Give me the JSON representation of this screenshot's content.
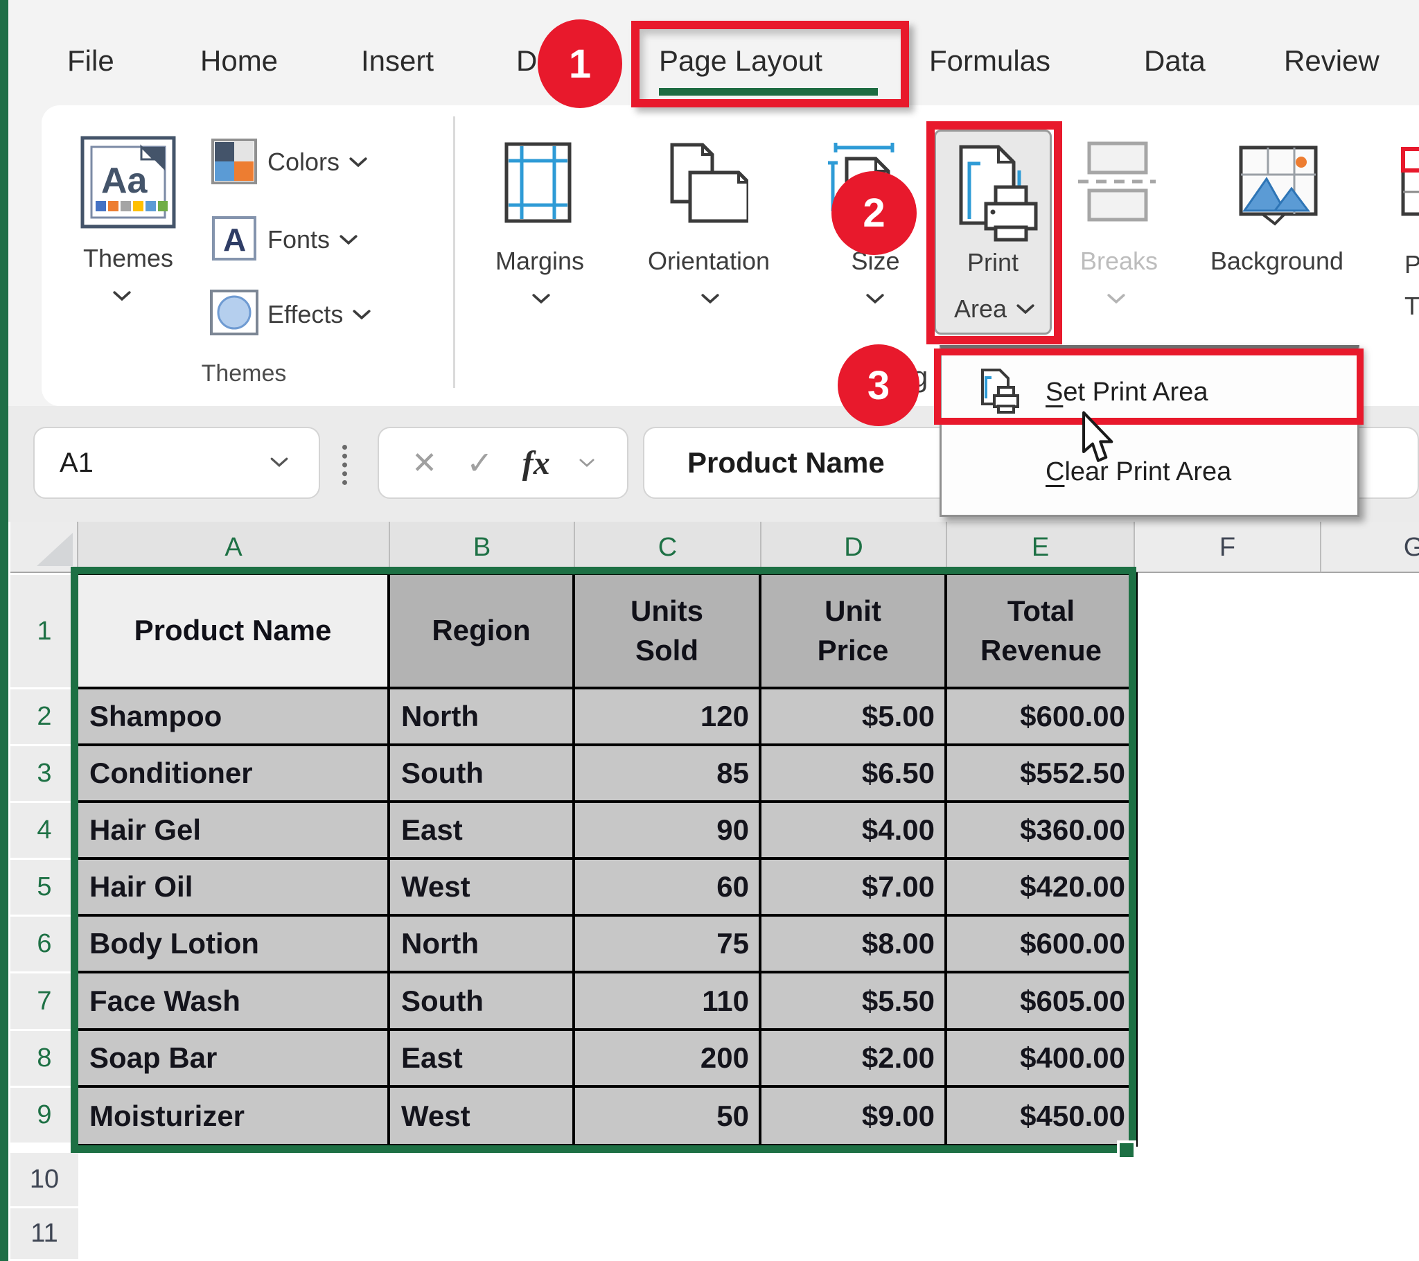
{
  "colors": {
    "excel_green": "#217346",
    "selection_border": "#1d7044",
    "annotation_red": "#e8192c",
    "disabled_text": "#bdbdbd"
  },
  "ribbon": {
    "tabs": [
      {
        "label": "File"
      },
      {
        "label": "Home"
      },
      {
        "label": "Insert"
      },
      {
        "label": "D"
      },
      {
        "label": "Page Layout"
      },
      {
        "label": "Formulas"
      },
      {
        "label": "Data"
      },
      {
        "label": "Review"
      }
    ],
    "active_tab": "Page Layout",
    "themes_group": {
      "group_label": "Themes",
      "themes_label": "Themes",
      "themes_icon_glyph": "Aa",
      "colors_label": "Colors",
      "fonts_label": "Fonts",
      "fonts_icon_glyph": "A",
      "effects_label": "Effects"
    },
    "page_setup_group": {
      "margins_label": "Margins",
      "orientation_label": "Orientation",
      "size_label": "Size",
      "print_area_line1": "Print",
      "print_area_line2": "Area",
      "breaks_label": "Breaks",
      "background_label": "Background",
      "print_titles_label": "Print\nTitles",
      "label_fragment": "g"
    }
  },
  "formula_bar": {
    "name_box_value": "A1",
    "cancel_glyph": "✕",
    "enter_glyph": "✓",
    "fx_label": "fx",
    "value": "Product Name"
  },
  "print_area_menu": {
    "items": [
      {
        "label": "Set Print Area"
      },
      {
        "label": "Clear Print Area"
      }
    ]
  },
  "annotations": {
    "badge_1": "1",
    "badge_2": "2",
    "badge_3": "3"
  },
  "sheet": {
    "active_cell": "A1",
    "column_headers": [
      "A",
      "B",
      "C",
      "D",
      "E",
      "F",
      "G"
    ],
    "selected_columns": [
      "A",
      "B",
      "C",
      "D",
      "E"
    ],
    "row_headers": [
      "1",
      "2",
      "3",
      "4",
      "5",
      "6",
      "7",
      "8",
      "9",
      "10",
      "11"
    ],
    "selected_rows": [
      "1",
      "2",
      "3",
      "4",
      "5",
      "6",
      "7",
      "8",
      "9"
    ],
    "table": {
      "headers": [
        "Product Name",
        "Region",
        "Units\nSold",
        "Unit\nPrice",
        "Total\nRevenue"
      ],
      "rows": [
        [
          "Shampoo",
          "North",
          "120",
          "$5.00",
          "$600.00"
        ],
        [
          "Conditioner",
          "South",
          "85",
          "$6.50",
          "$552.50"
        ],
        [
          "Hair Gel",
          "East",
          "90",
          "$4.00",
          "$360.00"
        ],
        [
          "Hair Oil",
          "West",
          "60",
          "$7.00",
          "$420.00"
        ],
        [
          "Body Lotion",
          "North",
          "75",
          "$8.00",
          "$600.00"
        ],
        [
          "Face Wash",
          "South",
          "110",
          "$5.50",
          "$605.00"
        ],
        [
          "Soap Bar",
          "East",
          "200",
          "$2.00",
          "$400.00"
        ],
        [
          "Moisturizer",
          "West",
          "50",
          "$9.00",
          "$450.00"
        ]
      ]
    }
  }
}
